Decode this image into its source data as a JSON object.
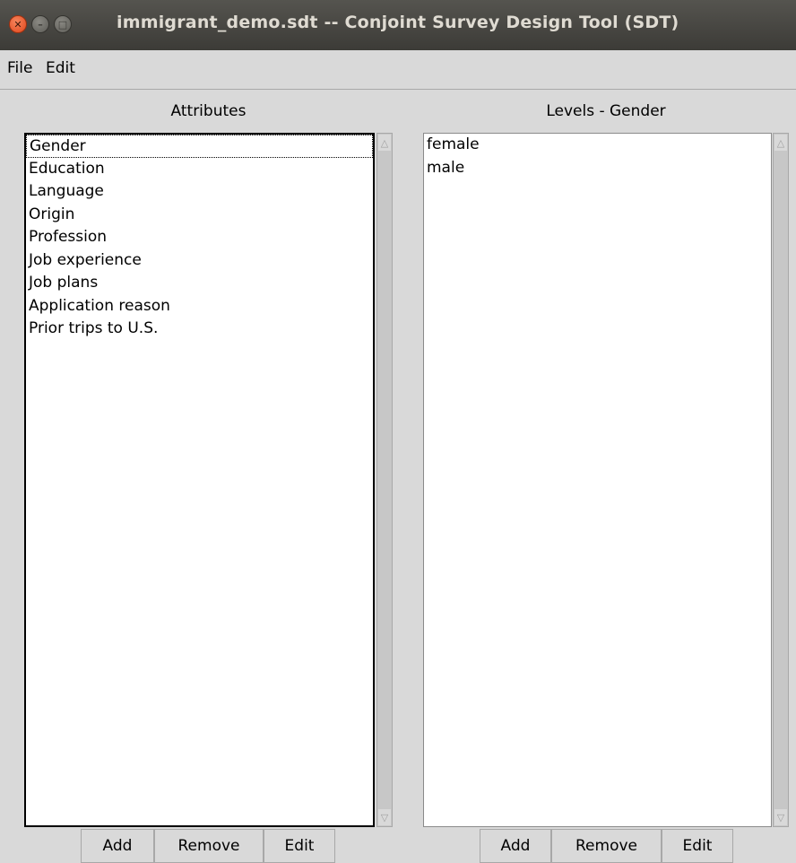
{
  "window": {
    "title": "immigrant_demo.sdt -- Conjoint Survey Design Tool (SDT)",
    "close_glyph": "✕",
    "minimize_glyph": "–",
    "maximize_glyph": "□"
  },
  "menu": {
    "items": [
      "File",
      "Edit"
    ]
  },
  "attributes": {
    "label": "Attributes",
    "items": [
      "Gender",
      "Education",
      "Language",
      "Origin",
      "Profession",
      "Job experience",
      "Job plans",
      "Application reason",
      "Prior trips to U.S."
    ],
    "selected": "Gender",
    "buttons": {
      "add": "Add",
      "remove": "Remove",
      "edit": "Edit"
    }
  },
  "levels": {
    "label": "Levels - Gender",
    "items": [
      "female",
      "male"
    ],
    "buttons": {
      "add": "Add",
      "remove": "Remove",
      "edit": "Edit"
    }
  },
  "scroll": {
    "up_glyph": "△",
    "down_glyph": "▽"
  }
}
